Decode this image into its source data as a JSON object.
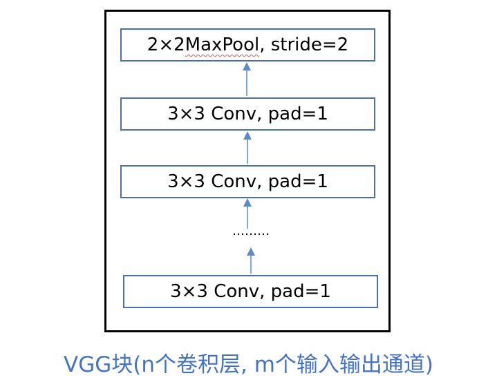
{
  "layers": {
    "pool": {
      "prefix": "2×2 ",
      "underlined": "MaxPool",
      "suffix": ", stride=2"
    },
    "conv_1": "3×3 Conv, pad=1",
    "conv_2": "3×3 Conv, pad=1",
    "conv_3": "3×3 Conv, pad=1"
  },
  "ellipsis": "………",
  "caption": "VGG块(n个卷积层, m个输入输出通道)",
  "colors": {
    "box_border": "#4a6fa5",
    "arrow": "#5b8ac7",
    "caption": "#4472c4",
    "frame": "#000000"
  }
}
